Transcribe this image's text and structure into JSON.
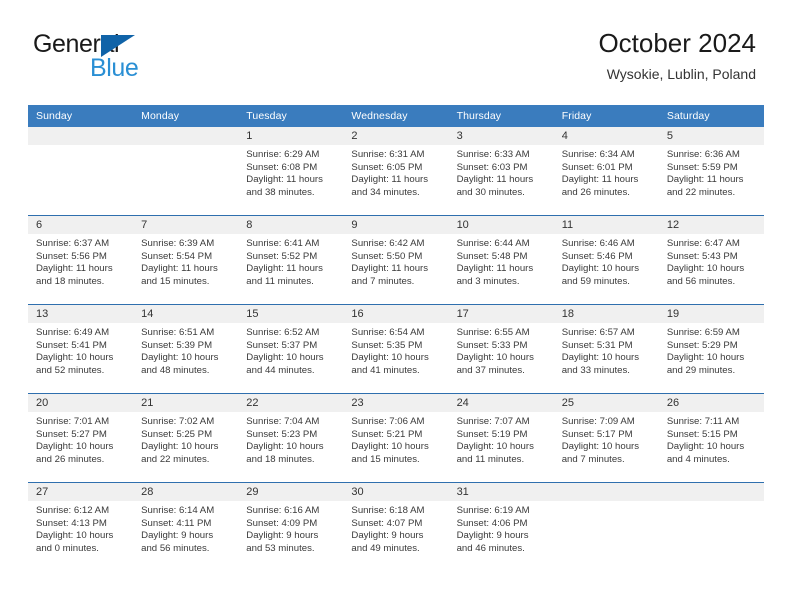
{
  "brand": {
    "name_part1": "General",
    "name_part2": "Blue",
    "accent_color": "#1063a8",
    "accent_color_light": "#2a8fd4",
    "triangle_icon": "triangle-icon"
  },
  "header": {
    "title": "October 2024",
    "subtitle": "Wysokie, Lublin, Poland"
  },
  "theme": {
    "header_row_bg": "#3a7cbe",
    "row_divider": "#2f6fae",
    "daynum_bg": "#f0f0f0"
  },
  "weekday_headers": [
    "Sunday",
    "Monday",
    "Tuesday",
    "Wednesday",
    "Thursday",
    "Friday",
    "Saturday"
  ],
  "labels": {
    "sunrise_prefix": "Sunrise:",
    "sunset_prefix": "Sunset:",
    "daylight_prefix": "Daylight:"
  },
  "weeks": [
    [
      {
        "day": "",
        "sunrise": "",
        "sunset": "",
        "daylight_line1": "",
        "daylight_line2": ""
      },
      {
        "day": "",
        "sunrise": "",
        "sunset": "",
        "daylight_line1": "",
        "daylight_line2": ""
      },
      {
        "day": "1",
        "sunrise": "Sunrise: 6:29 AM",
        "sunset": "Sunset: 6:08 PM",
        "daylight_line1": "Daylight: 11 hours",
        "daylight_line2": "and 38 minutes."
      },
      {
        "day": "2",
        "sunrise": "Sunrise: 6:31 AM",
        "sunset": "Sunset: 6:05 PM",
        "daylight_line1": "Daylight: 11 hours",
        "daylight_line2": "and 34 minutes."
      },
      {
        "day": "3",
        "sunrise": "Sunrise: 6:33 AM",
        "sunset": "Sunset: 6:03 PM",
        "daylight_line1": "Daylight: 11 hours",
        "daylight_line2": "and 30 minutes."
      },
      {
        "day": "4",
        "sunrise": "Sunrise: 6:34 AM",
        "sunset": "Sunset: 6:01 PM",
        "daylight_line1": "Daylight: 11 hours",
        "daylight_line2": "and 26 minutes."
      },
      {
        "day": "5",
        "sunrise": "Sunrise: 6:36 AM",
        "sunset": "Sunset: 5:59 PM",
        "daylight_line1": "Daylight: 11 hours",
        "daylight_line2": "and 22 minutes."
      }
    ],
    [
      {
        "day": "6",
        "sunrise": "Sunrise: 6:37 AM",
        "sunset": "Sunset: 5:56 PM",
        "daylight_line1": "Daylight: 11 hours",
        "daylight_line2": "and 18 minutes."
      },
      {
        "day": "7",
        "sunrise": "Sunrise: 6:39 AM",
        "sunset": "Sunset: 5:54 PM",
        "daylight_line1": "Daylight: 11 hours",
        "daylight_line2": "and 15 minutes."
      },
      {
        "day": "8",
        "sunrise": "Sunrise: 6:41 AM",
        "sunset": "Sunset: 5:52 PM",
        "daylight_line1": "Daylight: 11 hours",
        "daylight_line2": "and 11 minutes."
      },
      {
        "day": "9",
        "sunrise": "Sunrise: 6:42 AM",
        "sunset": "Sunset: 5:50 PM",
        "daylight_line1": "Daylight: 11 hours",
        "daylight_line2": "and 7 minutes."
      },
      {
        "day": "10",
        "sunrise": "Sunrise: 6:44 AM",
        "sunset": "Sunset: 5:48 PM",
        "daylight_line1": "Daylight: 11 hours",
        "daylight_line2": "and 3 minutes."
      },
      {
        "day": "11",
        "sunrise": "Sunrise: 6:46 AM",
        "sunset": "Sunset: 5:46 PM",
        "daylight_line1": "Daylight: 10 hours",
        "daylight_line2": "and 59 minutes."
      },
      {
        "day": "12",
        "sunrise": "Sunrise: 6:47 AM",
        "sunset": "Sunset: 5:43 PM",
        "daylight_line1": "Daylight: 10 hours",
        "daylight_line2": "and 56 minutes."
      }
    ],
    [
      {
        "day": "13",
        "sunrise": "Sunrise: 6:49 AM",
        "sunset": "Sunset: 5:41 PM",
        "daylight_line1": "Daylight: 10 hours",
        "daylight_line2": "and 52 minutes."
      },
      {
        "day": "14",
        "sunrise": "Sunrise: 6:51 AM",
        "sunset": "Sunset: 5:39 PM",
        "daylight_line1": "Daylight: 10 hours",
        "daylight_line2": "and 48 minutes."
      },
      {
        "day": "15",
        "sunrise": "Sunrise: 6:52 AM",
        "sunset": "Sunset: 5:37 PM",
        "daylight_line1": "Daylight: 10 hours",
        "daylight_line2": "and 44 minutes."
      },
      {
        "day": "16",
        "sunrise": "Sunrise: 6:54 AM",
        "sunset": "Sunset: 5:35 PM",
        "daylight_line1": "Daylight: 10 hours",
        "daylight_line2": "and 41 minutes."
      },
      {
        "day": "17",
        "sunrise": "Sunrise: 6:55 AM",
        "sunset": "Sunset: 5:33 PM",
        "daylight_line1": "Daylight: 10 hours",
        "daylight_line2": "and 37 minutes."
      },
      {
        "day": "18",
        "sunrise": "Sunrise: 6:57 AM",
        "sunset": "Sunset: 5:31 PM",
        "daylight_line1": "Daylight: 10 hours",
        "daylight_line2": "and 33 minutes."
      },
      {
        "day": "19",
        "sunrise": "Sunrise: 6:59 AM",
        "sunset": "Sunset: 5:29 PM",
        "daylight_line1": "Daylight: 10 hours",
        "daylight_line2": "and 29 minutes."
      }
    ],
    [
      {
        "day": "20",
        "sunrise": "Sunrise: 7:01 AM",
        "sunset": "Sunset: 5:27 PM",
        "daylight_line1": "Daylight: 10 hours",
        "daylight_line2": "and 26 minutes."
      },
      {
        "day": "21",
        "sunrise": "Sunrise: 7:02 AM",
        "sunset": "Sunset: 5:25 PM",
        "daylight_line1": "Daylight: 10 hours",
        "daylight_line2": "and 22 minutes."
      },
      {
        "day": "22",
        "sunrise": "Sunrise: 7:04 AM",
        "sunset": "Sunset: 5:23 PM",
        "daylight_line1": "Daylight: 10 hours",
        "daylight_line2": "and 18 minutes."
      },
      {
        "day": "23",
        "sunrise": "Sunrise: 7:06 AM",
        "sunset": "Sunset: 5:21 PM",
        "daylight_line1": "Daylight: 10 hours",
        "daylight_line2": "and 15 minutes."
      },
      {
        "day": "24",
        "sunrise": "Sunrise: 7:07 AM",
        "sunset": "Sunset: 5:19 PM",
        "daylight_line1": "Daylight: 10 hours",
        "daylight_line2": "and 11 minutes."
      },
      {
        "day": "25",
        "sunrise": "Sunrise: 7:09 AM",
        "sunset": "Sunset: 5:17 PM",
        "daylight_line1": "Daylight: 10 hours",
        "daylight_line2": "and 7 minutes."
      },
      {
        "day": "26",
        "sunrise": "Sunrise: 7:11 AM",
        "sunset": "Sunset: 5:15 PM",
        "daylight_line1": "Daylight: 10 hours",
        "daylight_line2": "and 4 minutes."
      }
    ],
    [
      {
        "day": "27",
        "sunrise": "Sunrise: 6:12 AM",
        "sunset": "Sunset: 4:13 PM",
        "daylight_line1": "Daylight: 10 hours",
        "daylight_line2": "and 0 minutes."
      },
      {
        "day": "28",
        "sunrise": "Sunrise: 6:14 AM",
        "sunset": "Sunset: 4:11 PM",
        "daylight_line1": "Daylight: 9 hours",
        "daylight_line2": "and 56 minutes."
      },
      {
        "day": "29",
        "sunrise": "Sunrise: 6:16 AM",
        "sunset": "Sunset: 4:09 PM",
        "daylight_line1": "Daylight: 9 hours",
        "daylight_line2": "and 53 minutes."
      },
      {
        "day": "30",
        "sunrise": "Sunrise: 6:18 AM",
        "sunset": "Sunset: 4:07 PM",
        "daylight_line1": "Daylight: 9 hours",
        "daylight_line2": "and 49 minutes."
      },
      {
        "day": "31",
        "sunrise": "Sunrise: 6:19 AM",
        "sunset": "Sunset: 4:06 PM",
        "daylight_line1": "Daylight: 9 hours",
        "daylight_line2": "and 46 minutes."
      },
      {
        "day": "",
        "sunrise": "",
        "sunset": "",
        "daylight_line1": "",
        "daylight_line2": ""
      },
      {
        "day": "",
        "sunrise": "",
        "sunset": "",
        "daylight_line1": "",
        "daylight_line2": ""
      }
    ]
  ]
}
